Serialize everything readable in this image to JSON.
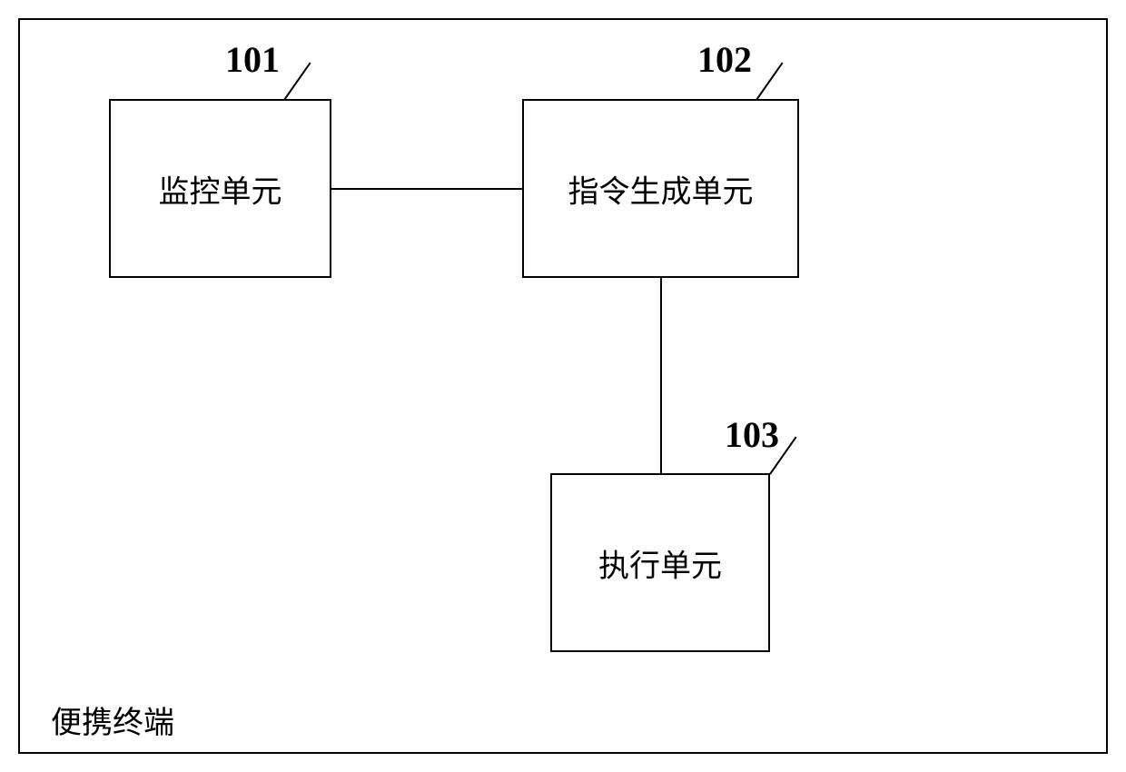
{
  "container_label": "便携终端",
  "boxes": [
    {
      "num": "101",
      "text": "监控单元"
    },
    {
      "num": "102",
      "text": "指令生成单元"
    },
    {
      "num": "103",
      "text": "执行单元"
    }
  ],
  "connections": [
    {
      "from": "101",
      "to": "102"
    },
    {
      "from": "102",
      "to": "103"
    }
  ]
}
